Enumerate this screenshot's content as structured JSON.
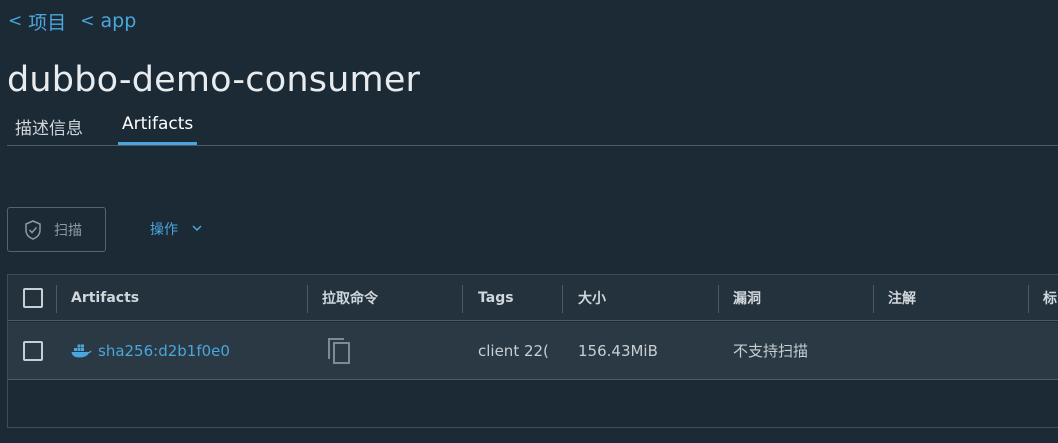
{
  "breadcrumb": [
    {
      "label": "项目"
    },
    {
      "label": "app"
    }
  ],
  "page_title": "dubbo-demo-consumer",
  "tabs": [
    {
      "label": "描述信息",
      "active": false
    },
    {
      "label": "Artifacts",
      "active": true
    }
  ],
  "toolbar": {
    "scan_label": "扫描",
    "action_label": "操作"
  },
  "table": {
    "headers": [
      "Artifacts",
      "拉取命令",
      "Tags",
      "大小",
      "漏洞",
      "注解",
      "标"
    ],
    "rows": [
      {
        "digest": "sha256:d2b1f0e0",
        "tags": "client  22(",
        "size": "156.43MiB",
        "vulnerabilities": "不支持扫描",
        "annotations": ""
      }
    ]
  },
  "colors": {
    "background": "#1c2a35",
    "accent": "#4aa6dd",
    "row_background": "#2a3943",
    "header_background": "#23323d"
  },
  "icons": {
    "breadcrumb_chevron": "chevron-left-icon",
    "scan": "shield-check-icon",
    "action_caret": "chevron-down-icon",
    "artifact": "docker-whale-icon",
    "pull_command": "copy-icon"
  }
}
